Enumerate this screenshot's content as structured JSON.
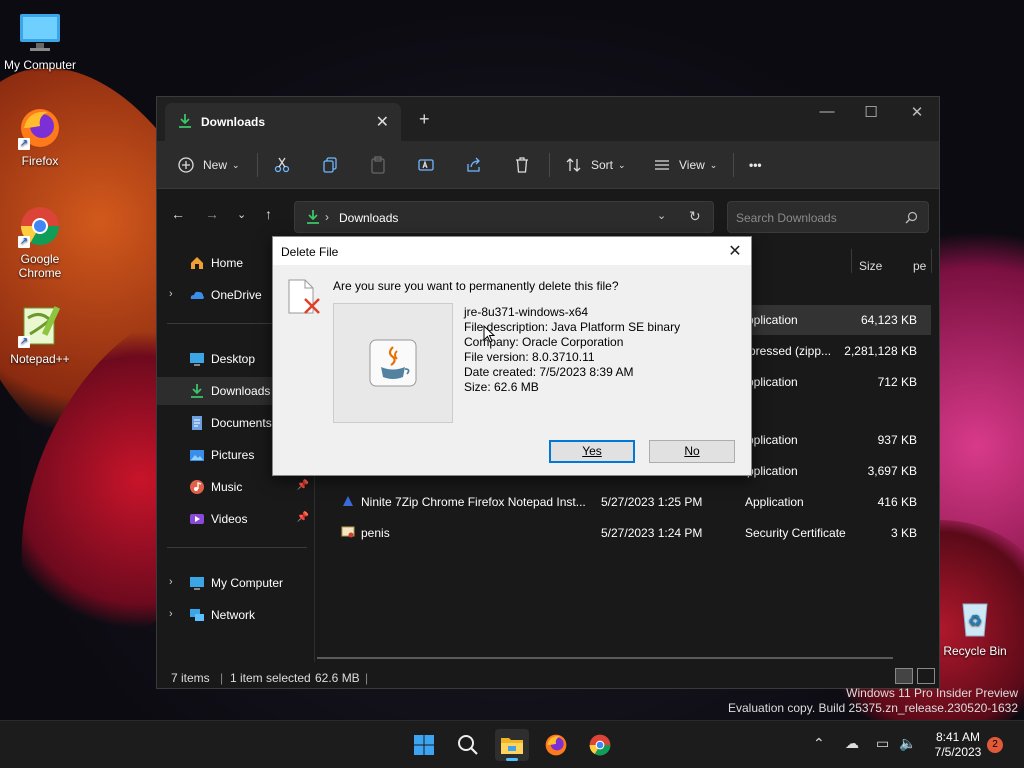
{
  "desktop": {
    "icons": [
      {
        "label": "My Computer",
        "icon": "monitor-icon"
      },
      {
        "label": "Firefox",
        "icon": "firefox-icon"
      },
      {
        "label": "Google Chrome",
        "icon": "chrome-icon"
      },
      {
        "label": "Notepad++",
        "icon": "notepadpp-icon"
      },
      {
        "label": "Recycle Bin",
        "icon": "recycle-bin-icon"
      }
    ]
  },
  "explorer": {
    "tab_title": "Downloads",
    "toolbar": {
      "new_label": "New",
      "sort_label": "Sort",
      "view_label": "View",
      "more_label": "•••"
    },
    "address": {
      "crumb": "Downloads"
    },
    "search": {
      "placeholder": "Search Downloads"
    },
    "nav": [
      {
        "label": "Home",
        "icon": "home-icon"
      },
      {
        "label": "OneDrive",
        "icon": "onedrive-icon"
      },
      {
        "label": "Desktop",
        "icon": "desktop-icon"
      },
      {
        "label": "Downloads",
        "icon": "download-icon"
      },
      {
        "label": "Documents",
        "icon": "documents-icon"
      },
      {
        "label": "Pictures",
        "icon": "pictures-icon"
      },
      {
        "label": "Music",
        "icon": "music-icon"
      },
      {
        "label": "Videos",
        "icon": "videos-icon"
      },
      {
        "label": "My Computer",
        "icon": "computer-icon"
      },
      {
        "label": "Network",
        "icon": "network-icon"
      }
    ],
    "columns": {
      "type": "pe",
      "size": "Size"
    },
    "rows": [
      {
        "name": "",
        "date": "",
        "type": "Application",
        "size": "64,123 KB"
      },
      {
        "name": "",
        "date": "",
        "type": "mpressed (zipp...",
        "size": "2,281,128 KB"
      },
      {
        "name": "",
        "date": "",
        "type": "Application",
        "size": "712 KB"
      },
      {
        "name": "",
        "date": "",
        "type": "Application",
        "size": "937 KB"
      },
      {
        "name": "",
        "date": "",
        "type": "Application",
        "size": "3,697 KB"
      },
      {
        "name": "Ninite 7Zip Chrome Firefox Notepad Inst...",
        "date": "5/27/2023 1:25 PM",
        "type": "Application",
        "size": "416 KB"
      },
      {
        "name": "penis",
        "date": "5/27/2023 1:24 PM",
        "type": "Security Certificate",
        "size": "3 KB"
      }
    ],
    "status": {
      "items": "7 items",
      "selected": "1 item selected",
      "size": "62.6 MB"
    }
  },
  "dialog": {
    "title": "Delete File",
    "question": "Are you sure you want to permanently delete this file?",
    "file_name": "jre-8u371-windows-x64",
    "description": "File description: Java Platform SE binary",
    "company": "Company: Oracle Corporation",
    "version": "File version: 8.0.3710.11",
    "date_created": "Date created: 7/5/2023 8:39 AM",
    "size": "Size: 62.6 MB",
    "yes_label": "Yes",
    "no_label": "No"
  },
  "watermark": {
    "line1": "Windows 11 Pro Insider Preview",
    "line2": "Evaluation copy. Build 25375.zn_release.230520-1632"
  },
  "taskbar": {
    "time": "8:41 AM",
    "date": "7/5/2023",
    "notifications": "2"
  },
  "colors": {
    "accent": "#4cc2ff",
    "dialog_bg": "#f0f0f0",
    "explorer_bg": "#191919"
  }
}
